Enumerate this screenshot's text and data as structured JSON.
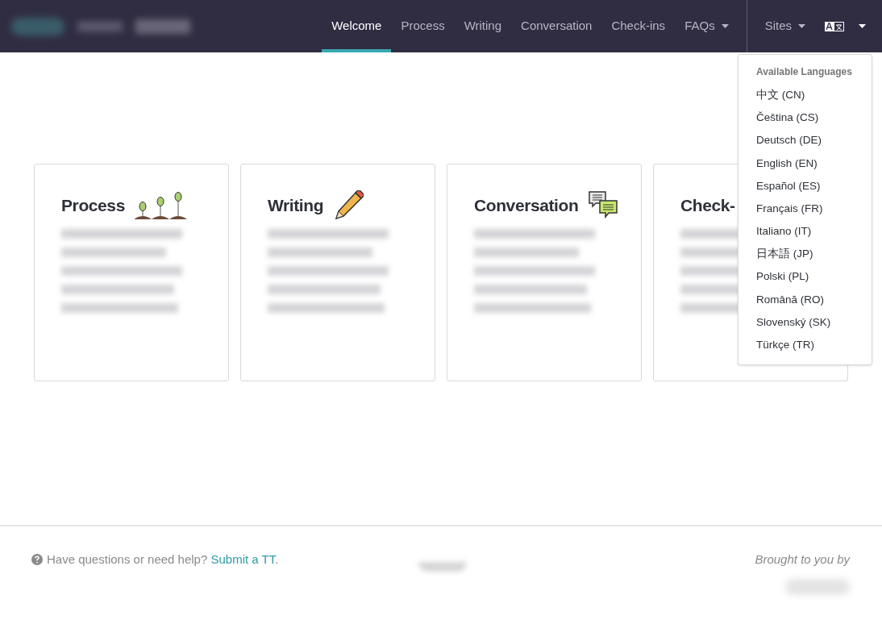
{
  "nav": {
    "items": [
      {
        "label": "Welcome",
        "selected": true,
        "caret": false
      },
      {
        "label": "Process",
        "selected": false,
        "caret": false
      },
      {
        "label": "Writing",
        "selected": false,
        "caret": false
      },
      {
        "label": "Conversation",
        "selected": false,
        "caret": false
      },
      {
        "label": "Check-ins",
        "selected": false,
        "caret": false
      },
      {
        "label": "FAQs",
        "selected": false,
        "caret": true
      }
    ],
    "sites": "Sites",
    "language_menu": {
      "expanded": true,
      "heading": "Available Languages",
      "options": [
        "中文 (CN)",
        "Čeština (CS)",
        "Deutsch (DE)",
        "English (EN)",
        "Español (ES)",
        "Français (FR)",
        "Italiano (IT)",
        "日本語 (JP)",
        "Polski (PL)",
        "Română (RO)",
        "Slovenský (SK)",
        "Türkçe (TR)"
      ]
    }
  },
  "cards": [
    {
      "title": "Process",
      "kind": "sprouts"
    },
    {
      "title": "Writing",
      "kind": "pencil"
    },
    {
      "title": "Conversation",
      "kind": "chat"
    },
    {
      "title": "Check-",
      "kind": "none"
    }
  ],
  "footer": {
    "help": "Have questions or need help?",
    "link": "Submit a TT",
    "after": ".",
    "credit": "Brought to you by"
  }
}
